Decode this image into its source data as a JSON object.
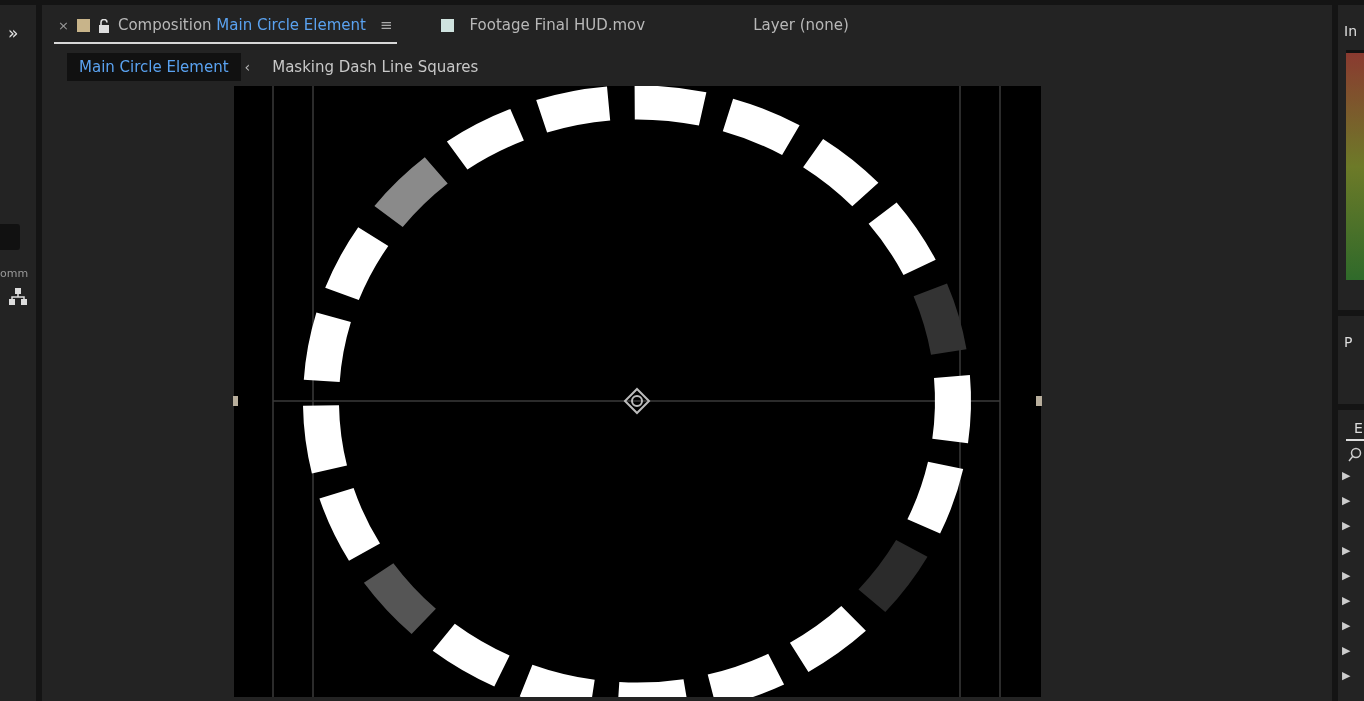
{
  "left_strip": {
    "expand_glyph": "»",
    "cut_label": "omm"
  },
  "tabs": [
    {
      "kind": "composition",
      "close": "×",
      "color": "#c8b48a",
      "locked": false,
      "prefix": "Composition",
      "label": "Main Circle Element",
      "menu": "≡",
      "selected": true
    },
    {
      "kind": "footage",
      "color": "#cfe3df",
      "label": "Footage Final HUD.mov",
      "selected": false
    },
    {
      "kind": "layer",
      "label": "Layer (none)",
      "selected": false
    }
  ],
  "breadcrumbs": [
    {
      "label": "Main Circle Element",
      "selected": true
    },
    {
      "label": "Masking Dash Line Squares",
      "selected": false
    }
  ],
  "breadcrumb_separator": "‹",
  "ring_segments": [
    {
      "color": "#ffffff"
    },
    {
      "color": "#333333"
    },
    {
      "color": "#ffffff"
    },
    {
      "color": "#ffffff"
    },
    {
      "color": "#ffffff"
    },
    {
      "color": "#ffffff"
    },
    {
      "color": "#ffffff"
    },
    {
      "color": "#ffffff"
    },
    {
      "color": "#8a8a8a"
    },
    {
      "color": "#ffffff"
    },
    {
      "color": "#ffffff"
    },
    {
      "color": "#ffffff"
    },
    {
      "color": "#ffffff"
    },
    {
      "color": "#555555"
    },
    {
      "color": "#ffffff"
    },
    {
      "color": "#ffffff"
    },
    {
      "color": "#ffffff"
    },
    {
      "color": "#ffffff"
    },
    {
      "color": "#ffffff"
    },
    {
      "color": "#2b2b2b"
    },
    {
      "color": "#ffffff"
    }
  ],
  "right_strip": {
    "info_label": "In",
    "panel_p_label": "P",
    "effects_tab": "E",
    "effect_rows": [
      "▶",
      "▶",
      "▶",
      "▶",
      "▶",
      "▶",
      "▶",
      "▶",
      "▶"
    ]
  }
}
